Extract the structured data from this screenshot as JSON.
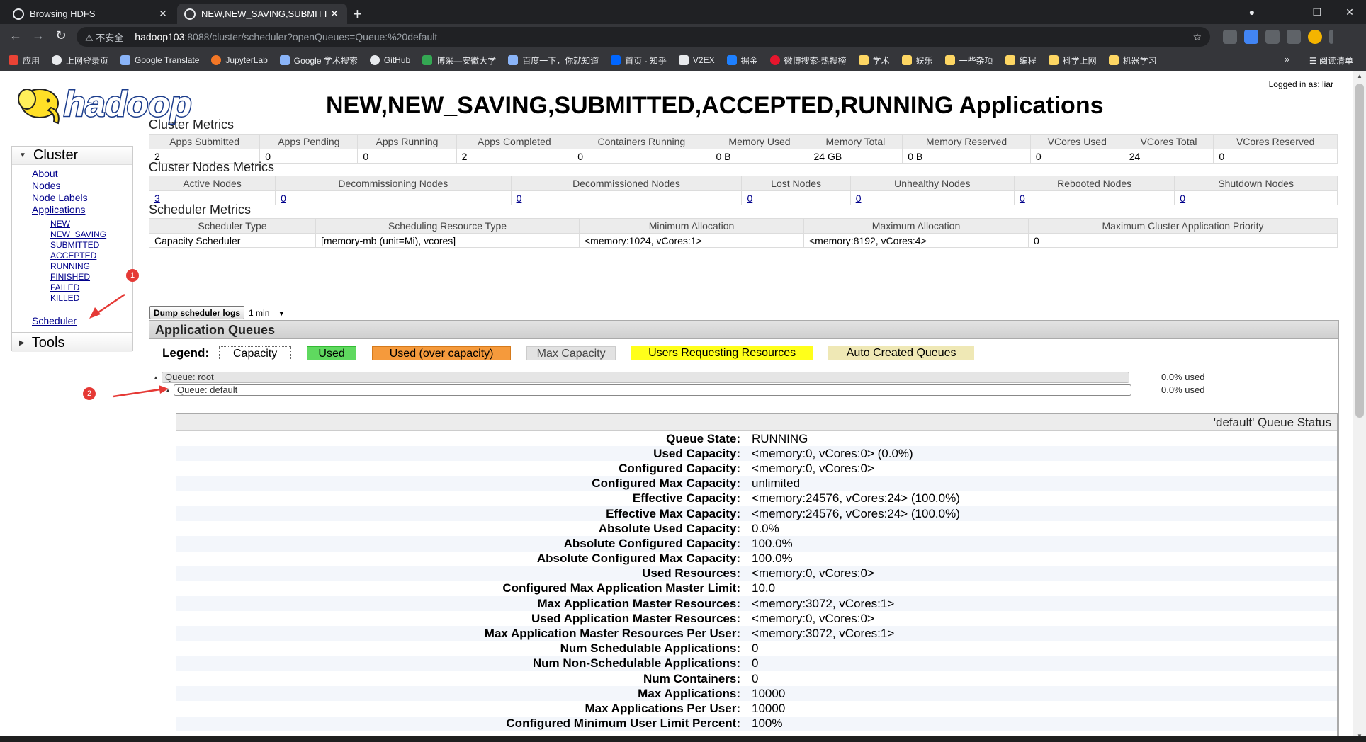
{
  "browser": {
    "tabs": [
      {
        "title": "Browsing HDFS"
      },
      {
        "title": "NEW,NEW_SAVING,SUBMITTE"
      }
    ],
    "new_tab": "+",
    "address": {
      "insecure_label": "不安全",
      "host": "hadoop103",
      "path": ":8088/cluster/scheduler?openQueues=Queue:%20default"
    },
    "bookmarks": [
      "应用",
      "上网登录页",
      "Google Translate",
      "JupyterLab",
      "Google 学术搜索",
      "GitHub",
      "博采—安徽大学",
      "百度一下，你就知道",
      "首页 - 知乎",
      "V2EX",
      "掘金",
      "微博搜索-热搜榜"
    ],
    "bookmark_folders": [
      "学术",
      "娱乐",
      "一些杂项",
      "编程",
      "科学上网",
      "机器学习"
    ],
    "reading_list": "阅读清单",
    "more": "»"
  },
  "header": {
    "title": "NEW,NEW_SAVING,SUBMITTED,ACCEPTED,RUNNING Applications",
    "logged_in": "Logged in as: liar",
    "logo_text": "hadoop"
  },
  "sidebar": {
    "cluster_label": "Cluster",
    "links": [
      "About",
      "Nodes",
      "Node Labels",
      "Applications"
    ],
    "app_states": [
      "NEW",
      "NEW_SAVING",
      "SUBMITTED",
      "ACCEPTED",
      "RUNNING",
      "FINISHED",
      "FAILED",
      "KILLED"
    ],
    "scheduler": "Scheduler",
    "tools_label": "Tools"
  },
  "annotations": {
    "one": "1",
    "two": "2"
  },
  "cluster_metrics": {
    "title": "Cluster Metrics",
    "headers": [
      "Apps Submitted",
      "Apps Pending",
      "Apps Running",
      "Apps Completed",
      "Containers Running",
      "Memory Used",
      "Memory Total",
      "Memory Reserved",
      "VCores Used",
      "VCores Total",
      "VCores Reserved"
    ],
    "values": [
      "2",
      "0",
      "0",
      "2",
      "0",
      "0 B",
      "24 GB",
      "0 B",
      "0",
      "24",
      "0"
    ]
  },
  "node_metrics": {
    "title": "Cluster Nodes Metrics",
    "headers": [
      "Active Nodes",
      "Decommissioning Nodes",
      "Decommissioned Nodes",
      "Lost Nodes",
      "Unhealthy Nodes",
      "Rebooted Nodes",
      "Shutdown Nodes"
    ],
    "values": [
      "3",
      "0",
      "0",
      "0",
      "0",
      "0",
      "0"
    ]
  },
  "scheduler_metrics": {
    "title": "Scheduler Metrics",
    "headers": [
      "Scheduler Type",
      "Scheduling Resource Type",
      "Minimum Allocation",
      "Maximum Allocation",
      "Maximum Cluster Application Priority"
    ],
    "values": [
      "Capacity Scheduler",
      "[memory-mb (unit=Mi), vcores]",
      "<memory:1024, vCores:1>",
      "<memory:8192, vCores:4>",
      "0"
    ]
  },
  "dump": {
    "button": "Dump scheduler logs",
    "interval": "1 min"
  },
  "queues": {
    "title": "Application Queues",
    "legend_label": "Legend:",
    "legend": [
      "Capacity",
      "Used",
      "Used (over capacity)",
      "Max Capacity",
      "Users Requesting Resources",
      "Auto Created Queues"
    ],
    "root": {
      "label": "Queue: root",
      "used": "0.0% used"
    },
    "default": {
      "label": "Queue: default",
      "used": "0.0% used"
    },
    "status_title": "'default' Queue Status",
    "status": [
      {
        "k": "Queue State:",
        "v": "RUNNING"
      },
      {
        "k": "Used Capacity:",
        "v": "<memory:0, vCores:0> (0.0%)"
      },
      {
        "k": "Configured Capacity:",
        "v": "<memory:0, vCores:0>"
      },
      {
        "k": "Configured Max Capacity:",
        "v": "unlimited"
      },
      {
        "k": "Effective Capacity:",
        "v": "<memory:24576, vCores:24> (100.0%)"
      },
      {
        "k": "Effective Max Capacity:",
        "v": "<memory:24576, vCores:24> (100.0%)"
      },
      {
        "k": "Absolute Used Capacity:",
        "v": "0.0%"
      },
      {
        "k": "Absolute Configured Capacity:",
        "v": "100.0%"
      },
      {
        "k": "Absolute Configured Max Capacity:",
        "v": "100.0%"
      },
      {
        "k": "Used Resources:",
        "v": "<memory:0, vCores:0>"
      },
      {
        "k": "Configured Max Application Master Limit:",
        "v": "10.0"
      },
      {
        "k": "Max Application Master Resources:",
        "v": "<memory:3072, vCores:1>"
      },
      {
        "k": "Used Application Master Resources:",
        "v": "<memory:0, vCores:0>"
      },
      {
        "k": "Max Application Master Resources Per User:",
        "v": "<memory:3072, vCores:1>"
      },
      {
        "k": "Num Schedulable Applications:",
        "v": "0"
      },
      {
        "k": "Num Non-Schedulable Applications:",
        "v": "0"
      },
      {
        "k": "Num Containers:",
        "v": "0"
      },
      {
        "k": "Max Applications:",
        "v": "10000"
      },
      {
        "k": "Max Applications Per User:",
        "v": "10000"
      },
      {
        "k": "Configured Minimum User Limit Percent:",
        "v": "100%"
      }
    ]
  }
}
